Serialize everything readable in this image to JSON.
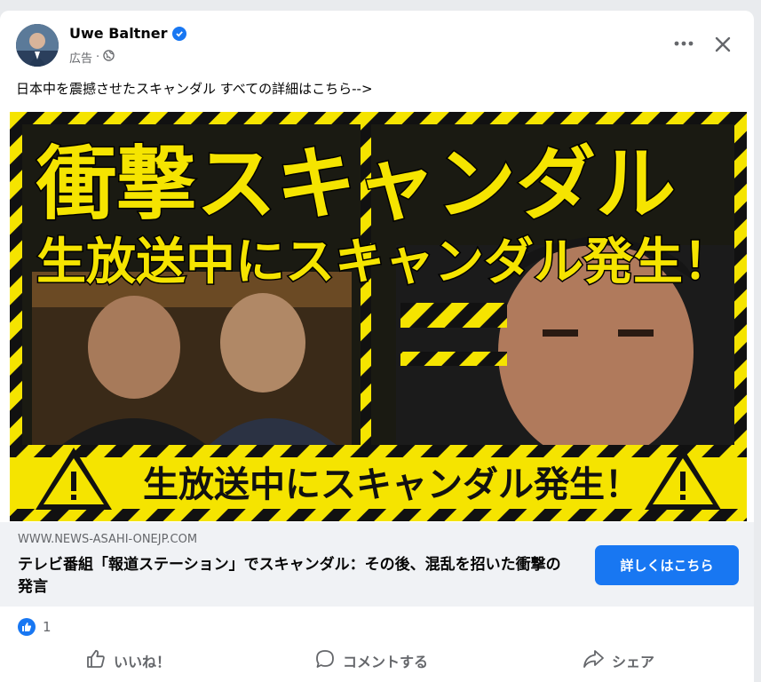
{
  "post": {
    "author": "Uwe Baltner",
    "sponsored_label": "広告",
    "meta_separator": "·",
    "caption": "日本中を震撼させたスキャンダル すべての詳細はこちら-->"
  },
  "ad_image": {
    "headline": "衝撃スキャンダル",
    "subhead": "生放送中にスキャンダル発生！",
    "banner": "生放送中にスキャンダル発生！"
  },
  "link_preview": {
    "domain": "WWW.NEWS-ASAHI-ONEJP.COM",
    "title": "テレビ番組「報道ステーション」でスキャンダル：その後、混乱を招いた衝撃の発言",
    "cta_label": "詳しくはこちら"
  },
  "reactions": {
    "count": "1"
  },
  "actions": {
    "like": "いいね！",
    "comment": "コメントする",
    "share": "シェア"
  },
  "colors": {
    "accent": "#1877f2",
    "warning_yellow": "#f5e400",
    "text_secondary": "#65676b"
  },
  "icons": [
    "verified-badge-icon",
    "globe-icon",
    "more-options-icon",
    "close-icon",
    "like-reaction-icon",
    "thumbs-up-icon",
    "comment-icon",
    "share-icon",
    "warning-icon"
  ]
}
